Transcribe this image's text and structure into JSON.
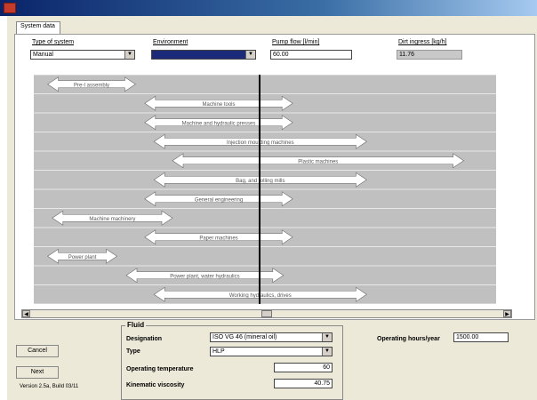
{
  "window": {
    "tab": "System data"
  },
  "header": {
    "system_type": {
      "label": "Type of system",
      "value": "Manual"
    },
    "environment": {
      "label": "Environment",
      "value": ""
    },
    "pump_flow": {
      "label": "Pump flow [l/min]",
      "value": "60.00"
    },
    "dirt_ingress": {
      "label": "Dirt ingress [kg/h]",
      "value": "11.76"
    }
  },
  "chart_data": {
    "type": "range-bar",
    "marker_line": true,
    "bars": [
      {
        "label": "Pre-I assembly",
        "start": 0.03,
        "end": 0.22
      },
      {
        "label": "Machine tools",
        "start": 0.24,
        "end": 0.56
      },
      {
        "label": "Machine and hydraulic presses",
        "start": 0.24,
        "end": 0.56
      },
      {
        "label": "Injection moulding machines",
        "start": 0.26,
        "end": 0.72
      },
      {
        "label": "Plastic machines",
        "start": 0.3,
        "end": 0.93
      },
      {
        "label": "Bag, and rolling mills",
        "start": 0.26,
        "end": 0.72
      },
      {
        "label": "General engineering",
        "start": 0.24,
        "end": 0.56
      },
      {
        "label": "Machine machinery",
        "start": 0.04,
        "end": 0.3
      },
      {
        "label": "Paper machines",
        "start": 0.24,
        "end": 0.56
      },
      {
        "label": "Power plant",
        "start": 0.03,
        "end": 0.18
      },
      {
        "label": "Power plant, water hydraulics",
        "start": 0.2,
        "end": 0.54
      },
      {
        "label": "Working hydraulics, drives",
        "start": 0.26,
        "end": 0.72
      }
    ]
  },
  "footer": {
    "cancel": "Cancel",
    "next": "Next",
    "version": "Version 2.5a, Build 03/11",
    "fluid_legend": "Fluid",
    "designation": {
      "label": "Designation",
      "value": "ISO VG 46 (mineral oil)"
    },
    "type": {
      "label": "Type",
      "value": "HLP"
    },
    "op_temp": {
      "label": "Operating temperature",
      "value": "60"
    },
    "kin_visc": {
      "label": "Kinematic viscosity",
      "value": "40.75"
    },
    "op_hours": {
      "label": "Operating hours/year",
      "value": "1500.00"
    }
  }
}
